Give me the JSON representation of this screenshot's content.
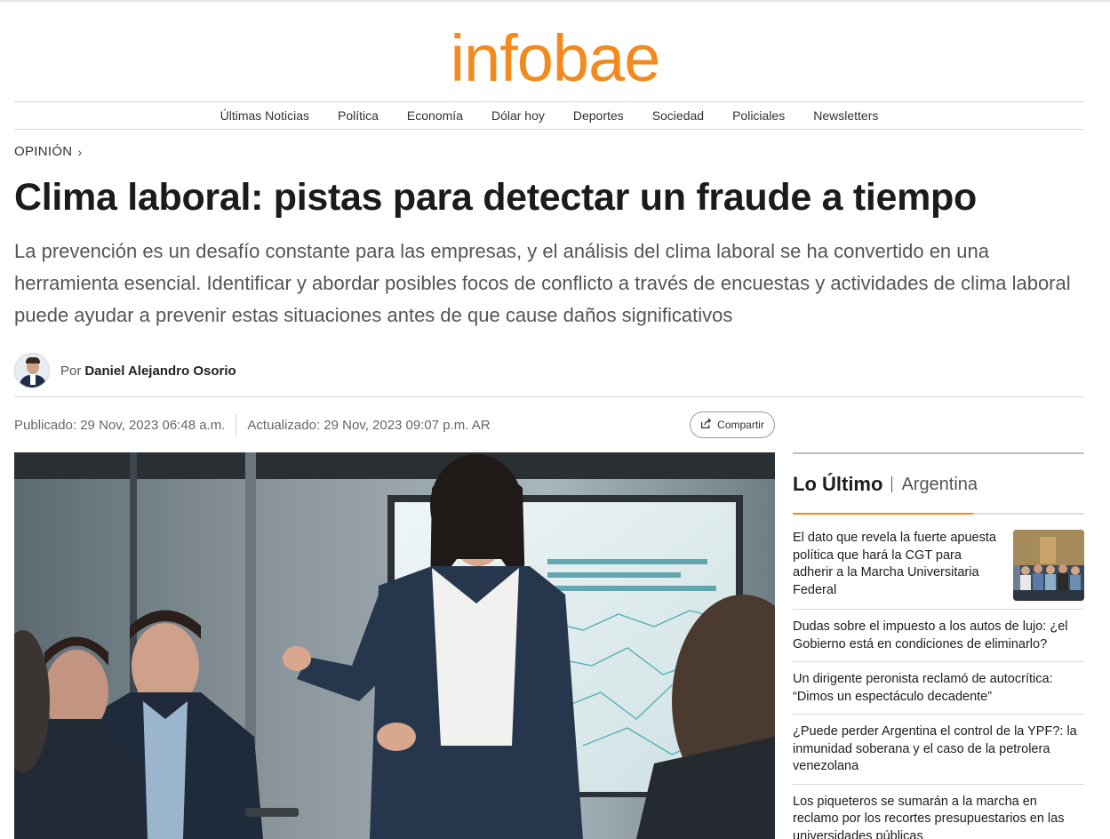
{
  "brand": {
    "logo_text": "infobae",
    "logo_color": "#f28a1e"
  },
  "nav": {
    "items": [
      {
        "label": "Últimas Noticias"
      },
      {
        "label": "Política"
      },
      {
        "label": "Economía"
      },
      {
        "label": "Dólar hoy"
      },
      {
        "label": "Deportes"
      },
      {
        "label": "Sociedad"
      },
      {
        "label": "Policiales"
      },
      {
        "label": "Newsletters"
      }
    ]
  },
  "article": {
    "section": "OPINIÓN",
    "section_icon": "chevron-right-icon",
    "headline": "Clima laboral: pistas para detectar un fraude a tiempo",
    "deck": "La prevención es un desafío constante para las empresas, y el análisis del clima laboral se ha convertido en una herramienta esencial. Identificar y abordar posibles focos de conflicto a través de encuestas y actividades de clima laboral puede ayudar a prevenir estas situaciones antes de que cause daños significativos",
    "author_prefix": "Por",
    "author_name": "Daniel Alejandro Osorio",
    "published": "Publicado: 29 Nov, 2023 06:48 a.m.",
    "updated": "Actualizado: 29 Nov, 2023 09:07 p.m. AR",
    "share_label": "Compartir",
    "share_icon": "share-icon"
  },
  "sidebar": {
    "title": "Lo Último",
    "subtitle": "Argentina",
    "accent_color": "#f28a1e",
    "items": [
      {
        "text": "El dato que revela la fuerte apuesta política que hará la CGT para adherir a la Marcha Universitaria Federal",
        "has_thumb": true
      },
      {
        "text": "Dudas sobre el impuesto a los autos de lujo: ¿el Gobierno está en condiciones de eliminarlo?"
      },
      {
        "text": "Un dirigente peronista reclamó de autocrítica: “Dimos un espectáculo decadente”"
      },
      {
        "text": "¿Puede perder Argentina el control de la YPF?: la inmunidad soberana y el caso de la petrolera venezolana"
      },
      {
        "text": "Los piqueteros se sumarán a la marcha en reclamo por los recortes presupuestarios en las universidades públicas"
      }
    ]
  }
}
